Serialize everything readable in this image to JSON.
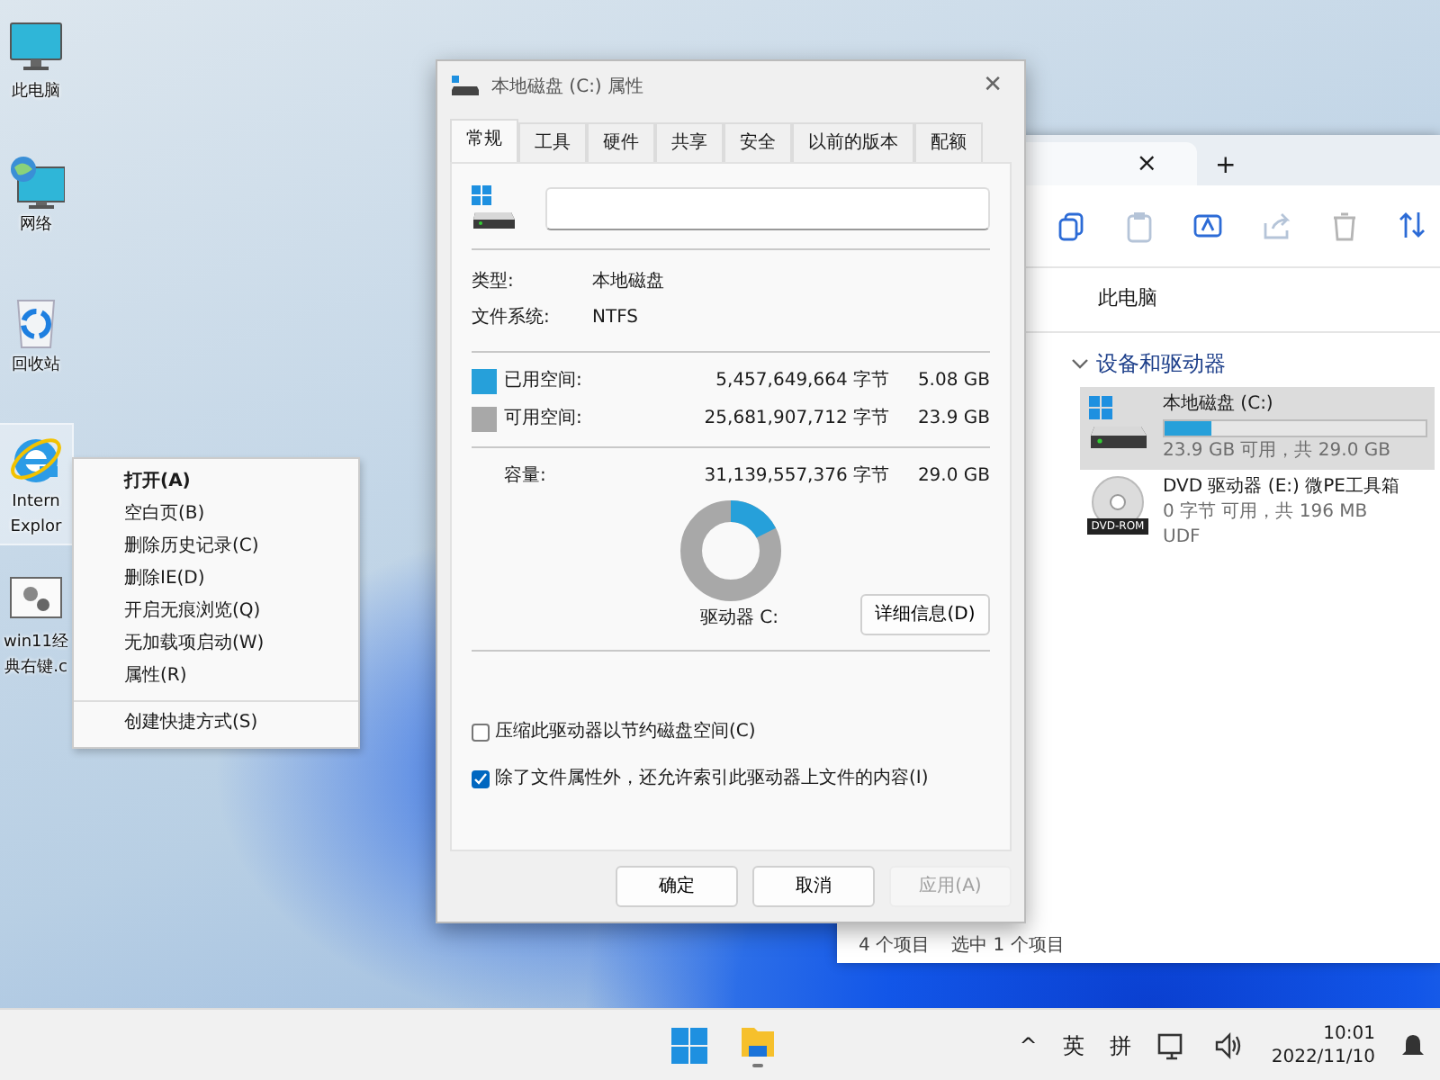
{
  "desktop": {
    "icons": [
      {
        "kind": "pc",
        "lines": [
          "此电脑"
        ],
        "selected": false
      },
      {
        "kind": "network",
        "lines": [
          "网络"
        ],
        "selected": false
      },
      {
        "kind": "recycle",
        "lines": [
          "回收站"
        ],
        "selected": false
      },
      {
        "kind": "ie",
        "lines": [
          "Intern",
          "Explor"
        ],
        "selected": true
      },
      {
        "kind": "shortcut",
        "lines": [
          "win11经",
          "典右键.c"
        ],
        "selected": false
      }
    ]
  },
  "context_menu": {
    "items": [
      {
        "label": "打开(A)",
        "default": true,
        "separator_before": false
      },
      {
        "label": "空白页(B)",
        "default": false,
        "separator_before": false
      },
      {
        "label": "删除历史记录(C)",
        "default": false,
        "separator_before": false
      },
      {
        "label": "删除IE(D)",
        "default": false,
        "separator_before": false
      },
      {
        "label": "开启无痕浏览(Q)",
        "default": false,
        "separator_before": false
      },
      {
        "label": "无加载项启动(W)",
        "default": false,
        "separator_before": false
      },
      {
        "label": "属性(R)",
        "default": false,
        "separator_before": false
      },
      {
        "label": "创建快捷方式(S)",
        "default": false,
        "separator_before": true
      }
    ]
  },
  "explorer": {
    "tab_close": "×",
    "new_tab": "+",
    "breadcrumb": "此电脑",
    "group": "设备和驱动器",
    "drives": [
      {
        "kind": "hdd",
        "name": "本地磁盘 (C:)",
        "level": 0.18,
        "detail": "23.9 GB 可用，共 29.0 GB",
        "selected": true
      },
      {
        "kind": "dvd",
        "name": "DVD 驱动器 (E:) 微PE工具箱",
        "icon_text": "DVD-ROM",
        "detail": "0 字节 可用，共 196 MB",
        "filesystem": "UDF",
        "selected": false
      }
    ],
    "status": [
      "4 个项目",
      "选中 1 个项目"
    ]
  },
  "properties_dialog": {
    "title": "本地磁盘 (C:) 属性",
    "close": "✕",
    "tabs": [
      {
        "label": "常规",
        "selected": true
      },
      {
        "label": "工具",
        "selected": false
      },
      {
        "label": "硬件",
        "selected": false
      },
      {
        "label": "共享",
        "selected": false
      },
      {
        "label": "安全",
        "selected": false
      },
      {
        "label": "以前的版本",
        "selected": false
      },
      {
        "label": "配额",
        "selected": false
      }
    ],
    "info": [
      {
        "label": "类型:",
        "value": "本地磁盘"
      },
      {
        "label": "文件系统:",
        "value": "NTFS"
      }
    ],
    "space": [
      {
        "label": "已用空间:",
        "bytes": "5,457,649,664 字节",
        "size": "5.08 GB",
        "color": "#26a0da"
      },
      {
        "label": "可用空间:",
        "bytes": "25,681,907,712 字节",
        "size": "23.9 GB",
        "color": "#a8a8a8"
      }
    ],
    "capacity": {
      "label": "容量:",
      "bytes": "31,139,557,376 字节",
      "size": "29.0 GB"
    },
    "level": 0.175,
    "drive_label": "驱动器 C:",
    "details_button": "详细信息(D)",
    "checkboxes": [
      {
        "label": "压缩此驱动器以节约磁盘空间(C)",
        "checked": false
      },
      {
        "label": "除了文件属性外，还允许索引此驱动器上文件的内容(I)",
        "checked": true
      }
    ],
    "buttons": [
      {
        "label": "确定",
        "disabled": false
      },
      {
        "label": "取消",
        "disabled": false
      },
      {
        "label": "应用(A)",
        "disabled": true
      }
    ]
  },
  "taskbar": {
    "tray": [
      "^",
      "英",
      "拼"
    ],
    "time": "10:01",
    "date": "2022/11/10"
  }
}
